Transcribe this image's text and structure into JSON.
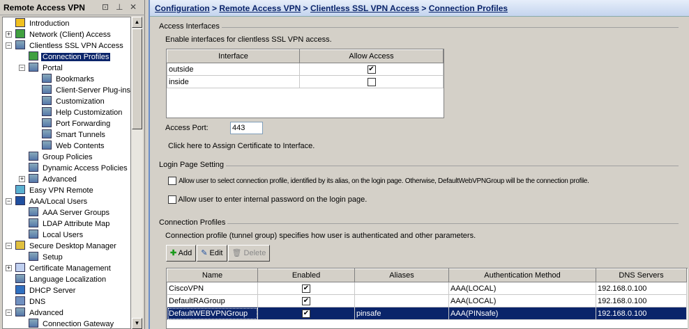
{
  "panel": {
    "title": "Remote Access VPN",
    "float": "⊡",
    "pin": "⊥",
    "close": "✕"
  },
  "tree": [
    {
      "label": "Introduction",
      "level": 0,
      "icon": "question-icon"
    },
    {
      "label": "Network (Client) Access",
      "level": 0,
      "exp": "+",
      "icon": "connection-icon"
    },
    {
      "label": "Clientless SSL VPN Access",
      "level": 0,
      "exp": "-",
      "icon": "portal-icon"
    },
    {
      "label": "Connection Profiles",
      "level": 1,
      "icon": "connection-icon",
      "selected": true
    },
    {
      "label": "Portal",
      "level": 1,
      "exp": "-",
      "icon": "portal-icon"
    },
    {
      "label": "Bookmarks",
      "level": 2,
      "icon": "bookmarks-icon"
    },
    {
      "label": "Client-Server Plug-ins",
      "level": 2,
      "icon": "plugin-icon"
    },
    {
      "label": "Customization",
      "level": 2,
      "icon": "customization-icon"
    },
    {
      "label": "Help Customization",
      "level": 2,
      "icon": "help-customization-icon"
    },
    {
      "label": "Port Forwarding",
      "level": 2,
      "icon": "port-forwarding-icon"
    },
    {
      "label": "Smart Tunnels",
      "level": 2,
      "icon": "smart-tunnels-icon"
    },
    {
      "label": "Web Contents",
      "level": 2,
      "icon": "web-contents-icon"
    },
    {
      "label": "Group Policies",
      "level": 1,
      "icon": "group-policies-icon"
    },
    {
      "label": "Dynamic Access Policies",
      "level": 1,
      "icon": "dynamic-access-icon"
    },
    {
      "label": "Advanced",
      "level": 1,
      "exp": "+",
      "icon": "advanced-icon"
    },
    {
      "label": "Easy VPN Remote",
      "level": 0,
      "icon": "easy-vpn-icon"
    },
    {
      "label": "AAA/Local Users",
      "level": 0,
      "exp": "-",
      "icon": "lock-icon"
    },
    {
      "label": "AAA Server Groups",
      "level": 1,
      "icon": "server-groups-icon"
    },
    {
      "label": "LDAP Attribute Map",
      "level": 1,
      "icon": "ldap-icon"
    },
    {
      "label": "Local Users",
      "level": 1,
      "icon": "users-icon"
    },
    {
      "label": "Secure Desktop Manager",
      "level": 0,
      "exp": "-",
      "icon": "padlock-icon"
    },
    {
      "label": "Setup",
      "level": 1,
      "icon": "gears-icon"
    },
    {
      "label": "Certificate Management",
      "level": 0,
      "exp": "+",
      "icon": "certificate-icon"
    },
    {
      "label": "Language Localization",
      "level": 0,
      "icon": "language-icon"
    },
    {
      "label": "DHCP Server",
      "level": 0,
      "icon": "dhcp-icon"
    },
    {
      "label": "DNS",
      "level": 0,
      "icon": "dns-icon"
    },
    {
      "label": "Advanced",
      "level": 0,
      "exp": "-",
      "icon": "advanced-icon"
    },
    {
      "label": "Connection Gateway",
      "level": 1,
      "icon": "gateway-icon"
    }
  ],
  "breadcrumb": {
    "items": [
      "Configuration",
      "Remote Access VPN",
      "Clientless SSL VPN Access",
      "Connection Profiles"
    ],
    "sep": " > "
  },
  "access": {
    "title": "Access Interfaces",
    "desc": "Enable interfaces for clientless SSL VPN access.",
    "columns": [
      "Interface",
      "Allow Access"
    ],
    "rows": [
      {
        "iface": "outside",
        "allow": true
      },
      {
        "iface": "inside",
        "allow": false
      }
    ],
    "port_label": "Access Port:",
    "port_value": "443",
    "cert_link": "Click here to Assign Certificate to Interface."
  },
  "login": {
    "title": "Login Page Setting",
    "opt1": "Allow user to select connection profile, identified by its alias, on the login page. Otherwise, DefaultWebVPNGroup will be the connection profile.",
    "opt2": "Allow user to enter internal password on the login page."
  },
  "profiles": {
    "title": "Connection Profiles",
    "desc": "Connection profile (tunnel group) specifies how user is authenticated and other parameters.",
    "add": "Add",
    "edit": "Edit",
    "delete": "Delete",
    "columns": [
      "Name",
      "Enabled",
      "Aliases",
      "Authentication Method",
      "DNS Servers"
    ],
    "rows": [
      {
        "name": "CiscoVPN",
        "enabled": true,
        "aliases": "",
        "auth": "AAA(LOCAL)",
        "dns": "192.168.0.100"
      },
      {
        "name": "DefaultRAGroup",
        "enabled": true,
        "aliases": "",
        "auth": "AAA(LOCAL)",
        "dns": "192.168.0.100"
      },
      {
        "name": "DefaultWEBVPNGroup",
        "enabled": true,
        "aliases": "pinsafe",
        "auth": "AAA(PINsafe)",
        "dns": "192.168.0.100",
        "selected": true
      }
    ]
  },
  "colors": {
    "selection": "#0a246a",
    "link": "#0a246a"
  }
}
